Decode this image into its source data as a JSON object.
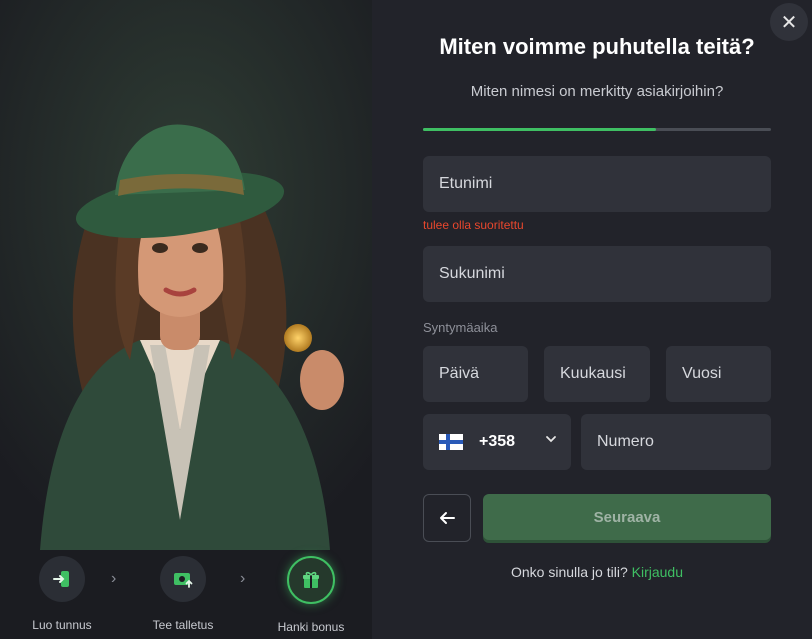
{
  "modal": {
    "close_icon": "close-icon",
    "title": "Miten voimme puhutella teitä?",
    "subtitle": "Miten nimesi on merkitty asiakirjoihin?",
    "progress": 0.67
  },
  "form": {
    "first_name_placeholder": "Etunimi",
    "first_name_error": "tulee olla suoritettu",
    "last_name_placeholder": "Sukunimi",
    "dob_label": "Syntymäaika",
    "day_placeholder": "Päivä",
    "month_placeholder": "Kuukausi",
    "year_placeholder": "Vuosi",
    "phone_code": "+358",
    "phone_flag_icon": "finland-flag-icon",
    "phone_placeholder": "Numero"
  },
  "actions": {
    "back_icon": "arrow-left-icon",
    "next_label": "Seuraava",
    "login_prompt": "Onko sinulla jo tili?",
    "login_link": "Kirjaudu"
  },
  "steps": [
    {
      "label": "Luo tunnus",
      "icon": "login-icon"
    },
    {
      "label": "Tee talletus",
      "icon": "deposit-icon"
    },
    {
      "label": "Hanki bonus",
      "icon": "gift-icon"
    }
  ],
  "colors": {
    "accent": "#3fbf63",
    "error": "#e8472d",
    "field_bg": "#30323a",
    "page_bg": "#22232a"
  }
}
